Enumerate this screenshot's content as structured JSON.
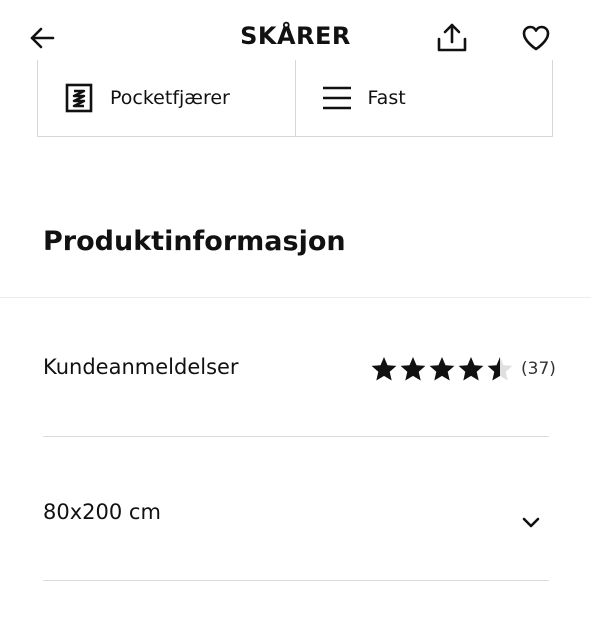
{
  "header": {
    "title": "SKÅRER",
    "back_icon": "arrow-left-icon",
    "share_icon": "share-upload-icon",
    "favorite_icon": "heart-outline-icon"
  },
  "features": [
    {
      "label": "Pocketfjærer",
      "icon": "spring-icon"
    },
    {
      "label": "Fast",
      "icon": "menu-lines-icon"
    }
  ],
  "section": {
    "title": "Produktinformasjon"
  },
  "reviews": {
    "label": "Kundeanmeldelser",
    "rating": 4.5,
    "max_rating": 5,
    "count_text": "(37)"
  },
  "size": {
    "label": "80x200 cm",
    "icon": "chevron-down-icon"
  },
  "colors": {
    "text": "#111111",
    "star_filled": "#111111",
    "star_empty": "#dfdfdf",
    "divider": "#dcdcdc"
  }
}
